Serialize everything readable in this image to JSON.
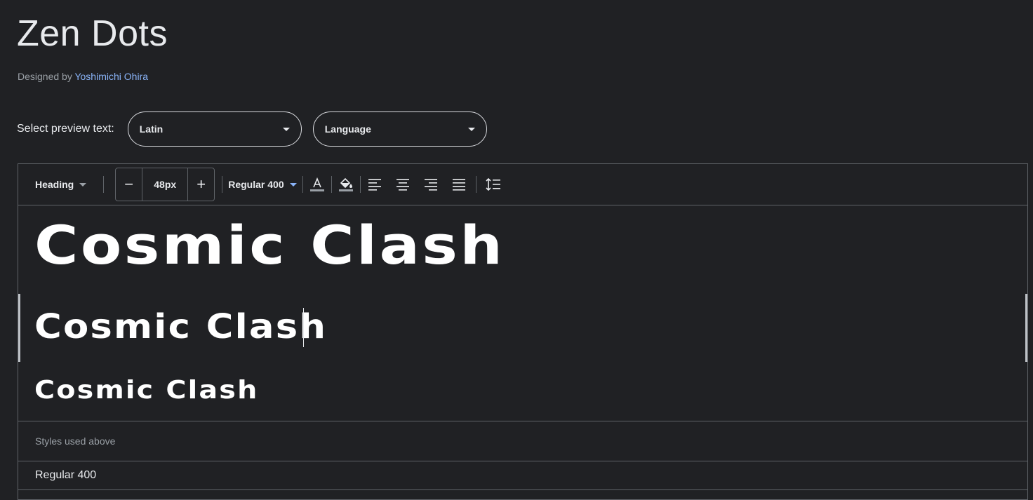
{
  "font": {
    "name": "Zen Dots",
    "designed_by_label": "Designed by",
    "designer": "Yoshimichi Ohira"
  },
  "preview_select": {
    "label": "Select preview text:",
    "script_value": "Latin",
    "language_value": "Language"
  },
  "toolbar": {
    "type_dropdown": "Heading",
    "size_value": "48px",
    "decrease_symbol": "−",
    "increase_symbol": "+",
    "weight_dropdown": "Regular 400",
    "icons": [
      "text-color-icon",
      "fill-color-icon",
      "align-left-icon",
      "align-center-icon",
      "align-right-icon",
      "align-justify-icon",
      "line-height-icon"
    ]
  },
  "preview": {
    "line1": "Cosmic Clash",
    "line2": "Cosmic Clash",
    "line3": "Cosmic Clash"
  },
  "styles_used": {
    "header": "Styles used above",
    "items": [
      "Regular 400"
    ]
  },
  "colors": {
    "background": "#202124",
    "text": "#e8eaed",
    "link": "#8ab4f8",
    "border": "#5f6368"
  }
}
